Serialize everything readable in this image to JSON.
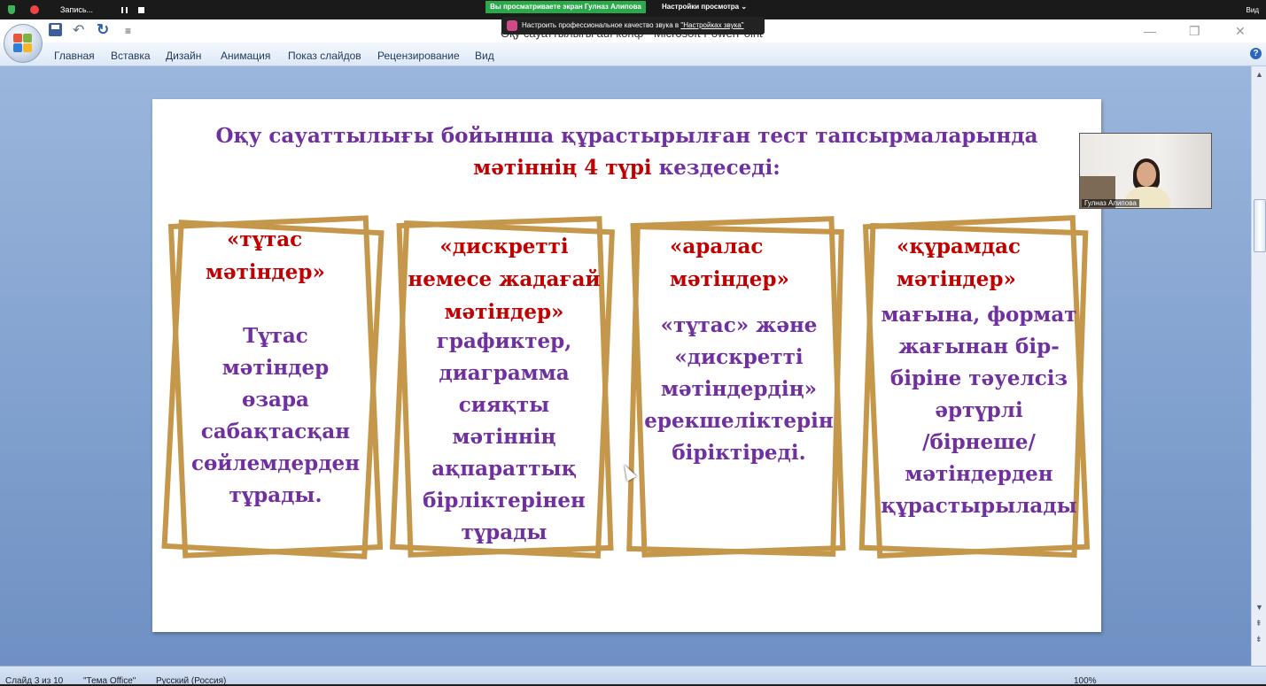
{
  "zoom": {
    "recording_label": "Запись...",
    "sharing_label": "Вы просматриваете экран Гулназ Алипова",
    "view_options_label": "Настройки просмотра ⌄",
    "view_label": "Вид",
    "tooltip_text": "Настроить профессиональное качество звука в",
    "tooltip_link": "\"Настройках звука\"",
    "participant_name": "Гулназ Алипова"
  },
  "window": {
    "title": "Оқу сауаттылығы auf конф - Microsoft PowerPoint",
    "minimize": "—",
    "restore": "❐",
    "close": "✕"
  },
  "ribbon": {
    "tabs": [
      "Главная",
      "Вставка",
      "Дизайн",
      "Анимация",
      "Показ слайдов",
      "Рецензирование",
      "Вид"
    ],
    "help": "?"
  },
  "status": {
    "slide_info": "Слайд 3 из 10",
    "theme": "\"Тема Office\"",
    "language": "Русский (Россия)",
    "zoom": "100%"
  },
  "slide": {
    "title_line1": "Оқу сауаттылығы бойынша құрастырылған тест тапсырмаларында",
    "title_line2_red": "мәтіннің 4 түрі",
    "title_line2_rest": " кездеседі:",
    "cards": [
      {
        "heading": [
          "«тұтас",
          "мәтіндер»"
        ],
        "body": [
          "Тұтас",
          "мәтіндер",
          "өзара",
          "сабақтасқан",
          "сөйлемдерден",
          "тұрады."
        ]
      },
      {
        "heading": [
          "«дискретті",
          "немесе жадағай",
          "мәтіндер»"
        ],
        "body": [
          "графиктер,",
          "диаграмма",
          "сияқты",
          "мәтіннің",
          "ақпараттық",
          "бірліктерінен",
          "тұрады"
        ]
      },
      {
        "heading": [
          "«аралас",
          "мәтіндер»"
        ],
        "body": [
          "«тұтас» және",
          "«дискретті",
          "мәтіндердің»",
          "ерекшеліктерін",
          "біріктіреді."
        ]
      },
      {
        "heading": [
          "«құрамдас",
          "мәтіндер»"
        ],
        "body": [
          "мағына, формат",
          "жағынан бір-",
          "біріне тәуелсіз",
          "әртүрлі",
          "/бірнеше/",
          "мәтіндерден",
          "құрастырылады"
        ]
      }
    ]
  },
  "colors": {
    "title_purple": "#7030a0",
    "heading_red": "#c00000",
    "frame_gold": "#c5974a"
  }
}
